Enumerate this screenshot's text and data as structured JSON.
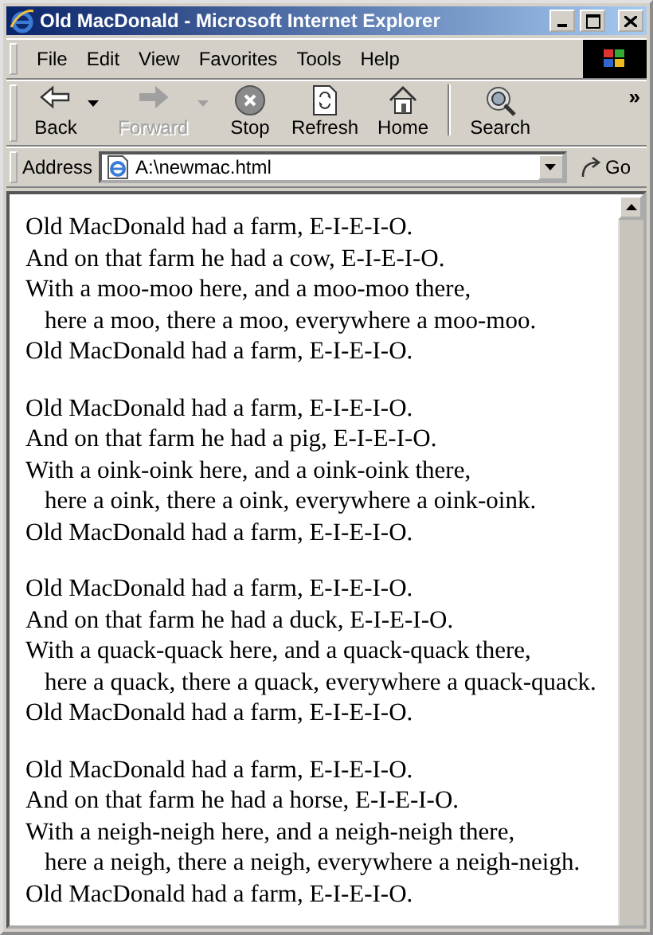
{
  "window": {
    "title": "Old MacDonald - Microsoft Internet Explorer"
  },
  "menu": [
    {
      "label": "File"
    },
    {
      "label": "Edit"
    },
    {
      "label": "View"
    },
    {
      "label": "Favorites"
    },
    {
      "label": "Tools"
    },
    {
      "label": "Help"
    }
  ],
  "toolbar": [
    {
      "label": "Back",
      "disabled": false,
      "dropdown": true
    },
    {
      "label": "Forward",
      "disabled": true,
      "dropdown": true
    },
    {
      "label": "Stop",
      "disabled": false,
      "dropdown": false
    },
    {
      "label": "Refresh",
      "disabled": false,
      "dropdown": false
    },
    {
      "label": "Home",
      "disabled": false,
      "dropdown": false
    },
    {
      "label": "Search",
      "disabled": false,
      "dropdown": false
    }
  ],
  "toolbar_more": "»",
  "address": {
    "label": "Address",
    "value": "A:\\newmac.html",
    "go": "Go"
  },
  "stanzas": [
    {
      "lines": [
        {
          "text": "Old MacDonald had a farm, E-I-E-I-O.",
          "indent": false
        },
        {
          "text": "And on that farm he had a cow, E-I-E-I-O.",
          "indent": false
        },
        {
          "text": "With a moo-moo here, and a moo-moo there,",
          "indent": false
        },
        {
          "text": "here a moo, there a moo, everywhere a moo-moo.",
          "indent": true
        },
        {
          "text": "Old MacDonald had a farm, E-I-E-I-O.",
          "indent": false
        }
      ]
    },
    {
      "lines": [
        {
          "text": "Old MacDonald had a farm, E-I-E-I-O.",
          "indent": false
        },
        {
          "text": "And on that farm he had a pig, E-I-E-I-O.",
          "indent": false
        },
        {
          "text": "With a oink-oink here, and a oink-oink there,",
          "indent": false
        },
        {
          "text": "here a oink, there a oink, everywhere a oink-oink.",
          "indent": true
        },
        {
          "text": "Old MacDonald had a farm, E-I-E-I-O.",
          "indent": false
        }
      ]
    },
    {
      "lines": [
        {
          "text": "Old MacDonald had a farm, E-I-E-I-O.",
          "indent": false
        },
        {
          "text": "And on that farm he had a duck, E-I-E-I-O.",
          "indent": false
        },
        {
          "text": "With a quack-quack here, and a quack-quack there,",
          "indent": false
        },
        {
          "text": "here a quack, there a quack, everywhere a quack-quack.",
          "indent": true
        },
        {
          "text": "Old MacDonald had a farm, E-I-E-I-O.",
          "indent": false
        }
      ]
    },
    {
      "lines": [
        {
          "text": "Old MacDonald had a farm, E-I-E-I-O.",
          "indent": false
        },
        {
          "text": "And on that farm he had a horse, E-I-E-I-O.",
          "indent": false
        },
        {
          "text": "With a neigh-neigh here, and a neigh-neigh there,",
          "indent": false
        },
        {
          "text": "here a neigh, there a neigh, everywhere a neigh-neigh.",
          "indent": true
        },
        {
          "text": "Old MacDonald had a farm, E-I-E-I-O.",
          "indent": false
        }
      ]
    }
  ]
}
